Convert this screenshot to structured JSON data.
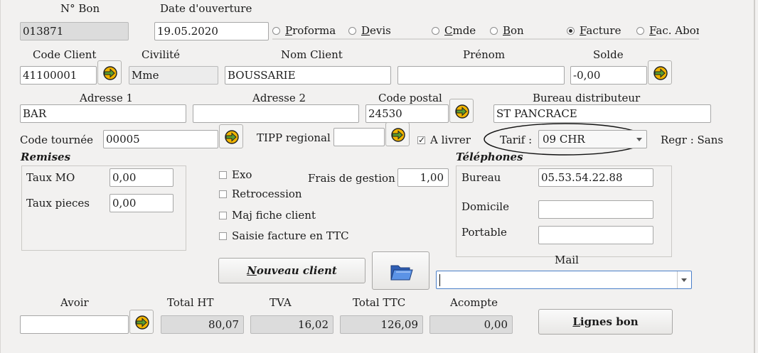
{
  "header": {
    "no_bon_label": "N° Bon",
    "no_bon_value": "013871",
    "date_label": "Date d'ouverture",
    "date_value": "19.05.2020"
  },
  "doc_type": {
    "options": [
      {
        "key": "P",
        "rest": "roforma"
      },
      {
        "key": "D",
        "rest": "evis"
      },
      {
        "key": "C",
        "rest": "mde"
      },
      {
        "key": "B",
        "rest": "on"
      },
      {
        "key": "F",
        "rest": "acture"
      },
      {
        "key": "F",
        "rest": "ac. Abon"
      }
    ],
    "selected": "Facture"
  },
  "client": {
    "code_label": "Code Client",
    "code_value": "41100001",
    "civilite_label": "Civilité",
    "civilite_value": "Mme",
    "nom_label": "Nom Client",
    "nom_value": "BOUSSARIE",
    "prenom_label": "Prénom",
    "prenom_value": "",
    "solde_label": "Solde",
    "solde_value": "-0,00"
  },
  "address": {
    "adresse1_label": "Adresse 1",
    "adresse1_value": "BAR",
    "adresse2_label": "Adresse 2",
    "adresse2_value": "",
    "cp_label": "Code postal",
    "cp_value": "24530",
    "bureau_label": "Bureau distributeur",
    "bureau_value": "ST PANCRACE"
  },
  "tournee": {
    "label": "Code tournée",
    "value": "00005",
    "tipp_label": "TIPP regional",
    "tipp_value": "",
    "a_livrer_label": "A livrer",
    "a_livrer_checked": true,
    "tarif_label": "Tarif :",
    "tarif_value": "09 CHR",
    "regr_label": "Regr : Sans"
  },
  "remises": {
    "title": "Remises",
    "taux_mo_label": "Taux MO",
    "taux_mo_value": "0,00",
    "taux_pieces_label": "Taux pieces",
    "taux_pieces_value": "0,00"
  },
  "options": {
    "exo": "Exo",
    "retrocession": "Retrocession",
    "maj_fiche": "Maj fiche client",
    "saisie_ttc": "Saisie facture en TTC",
    "frais_label": "Frais de gestion",
    "frais_value": "1,00"
  },
  "telephones": {
    "title": "Téléphones",
    "bureau_label": "Bureau",
    "bureau_value": "05.53.54.22.88",
    "domicile_label": "Domicile",
    "domicile_value": "",
    "portable_label": "Portable",
    "portable_value": ""
  },
  "actions": {
    "nouveau_key": "N",
    "nouveau_rest": "ouveau client",
    "lignes_key": "L",
    "lignes_rest": "ignes bon",
    "folder_icon": "folder-open-icon",
    "go_icon": "arrow-go-icon"
  },
  "mail": {
    "label": "Mail",
    "value": ""
  },
  "totals": {
    "avoir_label": "Avoir",
    "avoir_value": "",
    "ht_label": "Total HT",
    "ht_value": "80,07",
    "tva_label": "TVA",
    "tva_value": "16,02",
    "ttc_label": "Total TTC",
    "ttc_value": "126,09",
    "acompte_label": "Acompte",
    "acompte_value": "0,00"
  },
  "colors": {
    "go_orange": "#f0b400",
    "folder_blue": "#3d78d8",
    "ellipse": "#111111"
  }
}
